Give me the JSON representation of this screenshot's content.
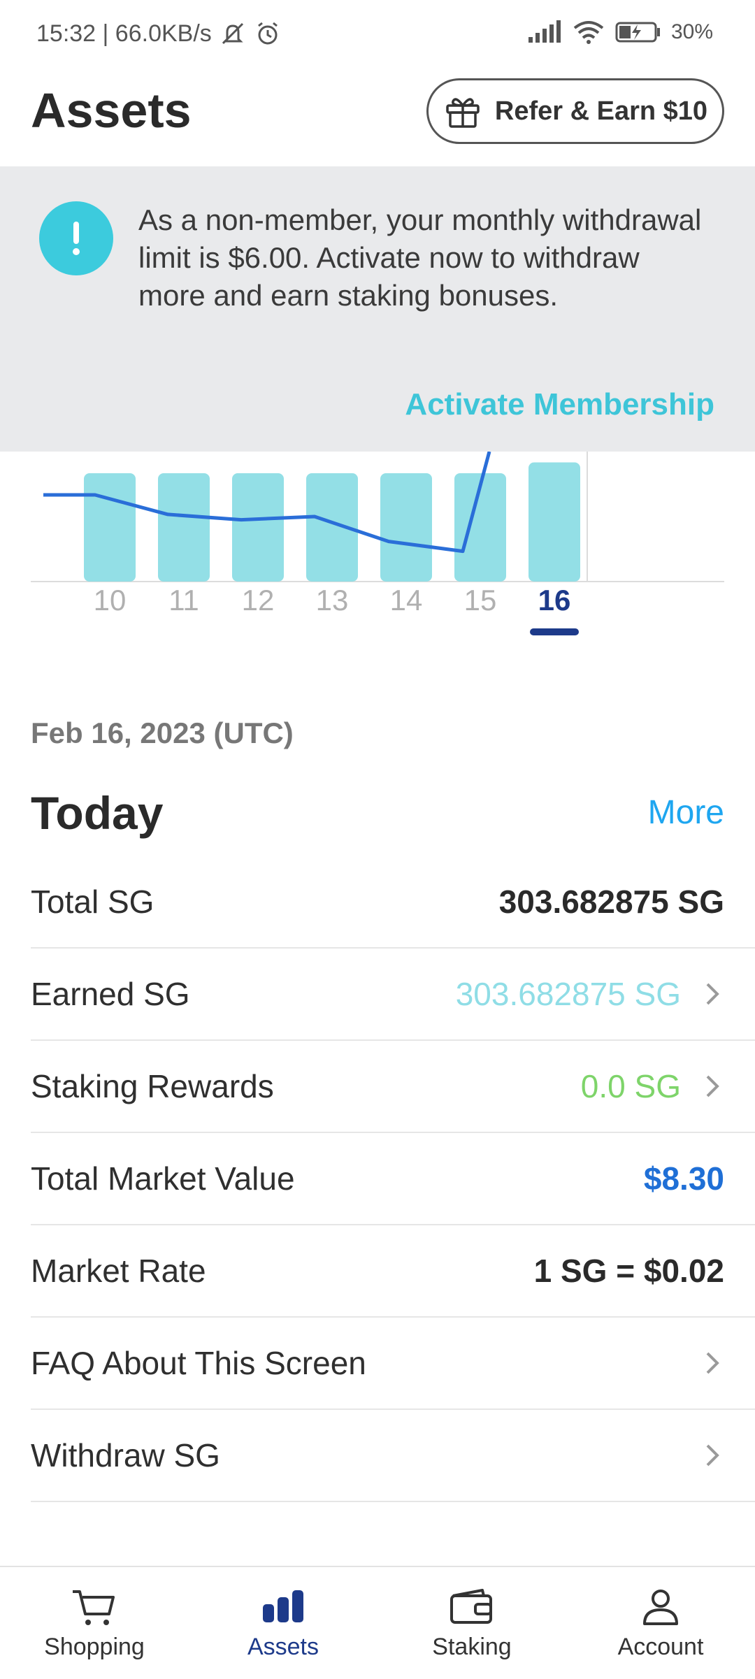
{
  "status_bar": {
    "time_speed": "15:32 | 66.0KB/s",
    "battery": "30%",
    "icons": [
      "mute-icon",
      "alarm-icon",
      "signal-icon",
      "wifi-icon",
      "battery-icon"
    ]
  },
  "header": {
    "title": "Assets",
    "refer_button": "Refer & Earn $10"
  },
  "banner": {
    "message": "As a non-member, your monthly withdrawal limit is $6.00. Activate now to withdraw more and earn staking bonuses.",
    "link": "Activate Membership",
    "icon": "!"
  },
  "chart_data": {
    "type": "bar",
    "categories": [
      "10",
      "11",
      "12",
      "13",
      "14",
      "15",
      "16"
    ],
    "selected_category": "16",
    "bar_values": [
      10,
      10,
      10,
      10,
      10,
      10,
      11
    ],
    "line_values": [
      8,
      8,
      6.2,
      5.7,
      6,
      3.7,
      2.8,
      12
    ],
    "colors": {
      "bar": "#93dfe6",
      "line": "#2a6ed8",
      "selected": "#1d3a8a",
      "tick": "#b0b0b0"
    }
  },
  "chart_labels": [
    "10",
    "11",
    "12",
    "13",
    "14",
    "15",
    "16"
  ],
  "summary": {
    "date": "Feb 16, 2023 (UTC)",
    "title": "Today",
    "more": "More",
    "rows": [
      {
        "label": "Total SG",
        "value": "303.682875 SG"
      },
      {
        "label": "Earned SG",
        "value": "303.682875 SG"
      },
      {
        "label": "Staking Rewards",
        "value": "0.0 SG"
      },
      {
        "label": "Total Market Value",
        "value": "$8.30"
      },
      {
        "label": "Market Rate",
        "value": "1 SG = $0.02"
      },
      {
        "label": "FAQ About This Screen",
        "value": ""
      },
      {
        "label": "Withdraw SG",
        "value": ""
      }
    ]
  },
  "bottom_nav": {
    "items": [
      {
        "label": "Shopping",
        "icon": "cart-icon"
      },
      {
        "label": "Assets",
        "icon": "bar-chart-icon"
      },
      {
        "label": "Staking",
        "icon": "wallet-icon"
      },
      {
        "label": "Account",
        "icon": "person-icon"
      }
    ],
    "active": "Assets"
  }
}
